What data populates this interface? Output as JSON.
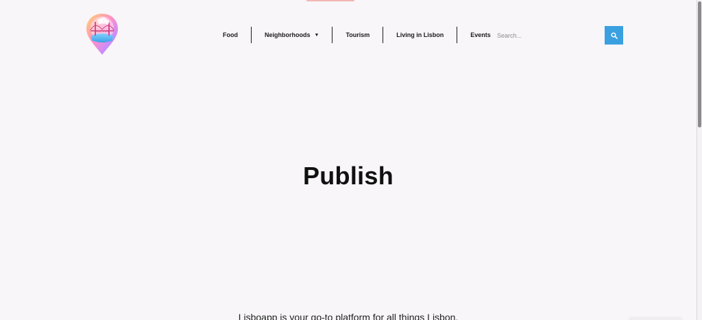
{
  "header": {
    "logo_icon": "bridge-map-pin-icon",
    "nav": [
      {
        "label": "Food"
      },
      {
        "label": "Neighborhoods",
        "has_dropdown": true
      },
      {
        "label": "Tourism"
      },
      {
        "label": "Living in Lisbon"
      },
      {
        "label": "Events"
      }
    ],
    "search": {
      "placeholder": "Search...",
      "button_icon": "search-icon"
    }
  },
  "main": {
    "title": "Publish",
    "intro": "Lisboapp is your go-to platform for all things Lisbon."
  },
  "colors": {
    "accent": "#3aa0e0",
    "background": "#f8f6f8",
    "text": "#111111"
  }
}
